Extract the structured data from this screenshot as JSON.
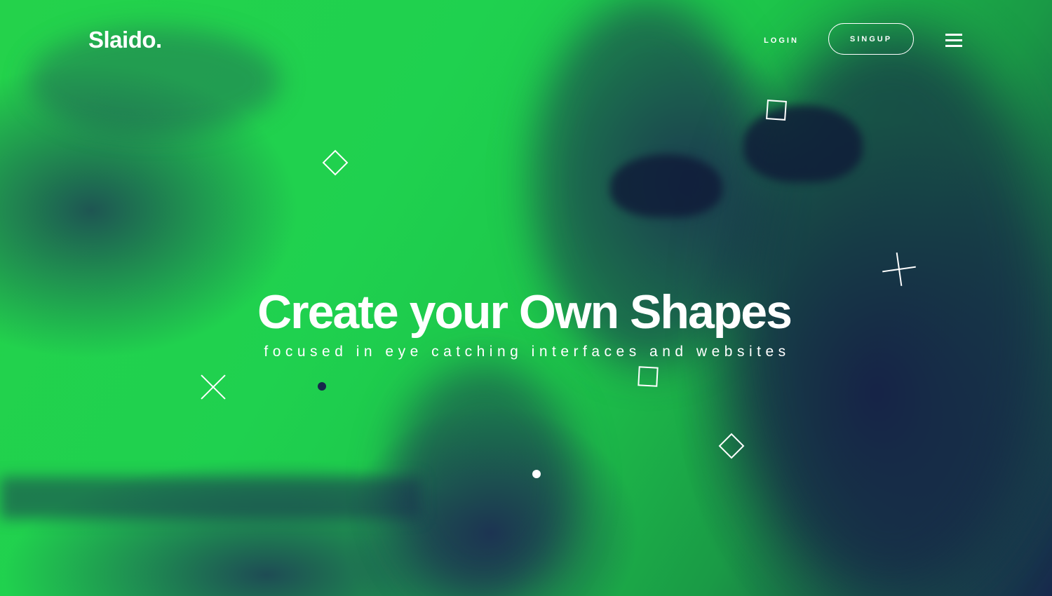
{
  "brand": {
    "logo_text": "Slaido."
  },
  "nav": {
    "login_label": "LOGIN",
    "signup_label": "SINGUP",
    "menu_icon": "hamburger-menu-icon"
  },
  "hero": {
    "headline": "Create your Own Shapes",
    "subline": "focused in eye catching interfaces and websites"
  },
  "colors": {
    "accent_green": "#24d24b",
    "navy": "#17284c",
    "text": "#ffffff"
  },
  "shape_icons": [
    "diamond-shape",
    "square-shape",
    "x-shape",
    "plus-shape",
    "dot-shape"
  ]
}
